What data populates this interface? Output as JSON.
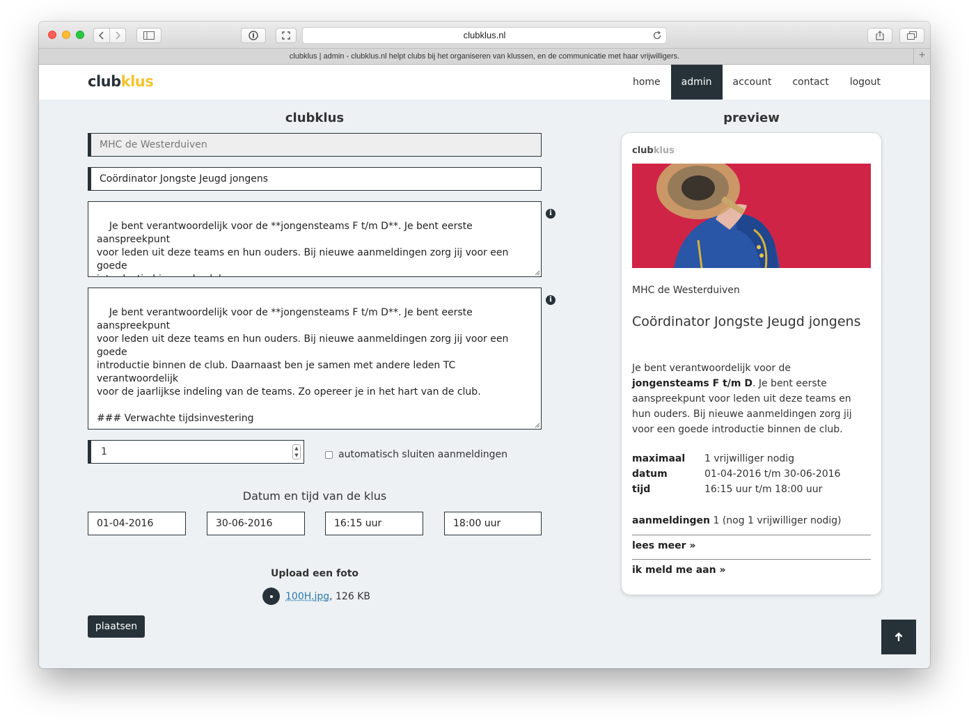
{
  "browser": {
    "url": "clubklus.nl",
    "tab_title": "clubklus | admin - clubklus.nl helpt clubs bij het organiseren van klussen, en de communicatie met haar vrijwilligers."
  },
  "logo": {
    "part1": "club",
    "part2": "klus"
  },
  "nav": {
    "home": "home",
    "admin": "admin",
    "account": "account",
    "contact": "contact",
    "logout": "logout"
  },
  "form": {
    "title": "clubklus",
    "club_name": "MHC de Westerduiven",
    "job_title": "Coördinator Jongste Jeugd jongens",
    "summary": "Je bent verantwoordelijk voor de **jongensteams F t/m D**. Je bent eerste aanspreekpunt\nvoor leden uit deze teams en hun ouders. Bij nieuwe aanmeldingen zorg jij voor een goede\nintroductie binnen de club.",
    "description": "Je bent verantwoordelijk voor de **jongensteams F t/m D**. Je bent eerste aanspreekpunt\nvoor leden uit deze teams en hun ouders. Bij nieuwe aanmeldingen zorg jij voor een goede\nintroductie binnen de club. Daarnaast ben je samen met andere leden TC verantwoordelijk\nvoor de jaarlijkse indeling van de teams. Zo opereer je in het hart van de club.\n\n### Verwachte tijdsinvestering\n\n* Hockeyervaring is niet noodzakelijk.\n* De selectiecommissie bestaat uit onafhankelijke leden met veel hockeykennis en ervaring.\n* Je hebt meer een coördinerende en informerende functie.\n* Goede communicatie vaardigheden zijn een vereiste.",
    "quantity": "1",
    "auto_close_label": "automatisch sluiten aanmeldingen",
    "date_section_title": "Datum en tijd van de klus",
    "start_date": "01-04-2016",
    "end_date": "30-06-2016",
    "start_time": "16:15 uur",
    "end_time": "18:00 uur",
    "upload_title": "Upload een foto",
    "file_name": "100H.jpg",
    "file_size": ", 126 KB",
    "submit_label": "plaatsen"
  },
  "preview": {
    "title": "preview",
    "logo_part1": "club",
    "logo_part2": "klus",
    "club_name": "MHC de Westerduiven",
    "job_title": "Coördinator Jongste Jeugd jongens",
    "desc_before": "Je bent verantwoordelijk voor de ",
    "desc_bold": "jongensteams F t/m D",
    "desc_after": ". Je bent eerste aanspreekpunt voor leden uit deze teams en hun ouders. Bij nieuwe aanmeldingen zorg jij voor een goede introductie binnen de club.",
    "max_label": "maximaal",
    "max_value": "1 vrijwilliger nodig",
    "date_label": "datum",
    "date_value": "01-04-2016 t/m 30-06-2016",
    "time_label": "tijd",
    "time_value": "16:15 uur t/m 18:00 uur",
    "reg_label": "aanmeldingen",
    "reg_value": " 1 (nog 1 vrijwilliger nodig)",
    "read_more": "lees meer »",
    "sign_up": "ik meld me aan »"
  },
  "colors": {
    "dark": "#263238",
    "accent": "#f4c430",
    "image_bg": "#d4264b"
  }
}
